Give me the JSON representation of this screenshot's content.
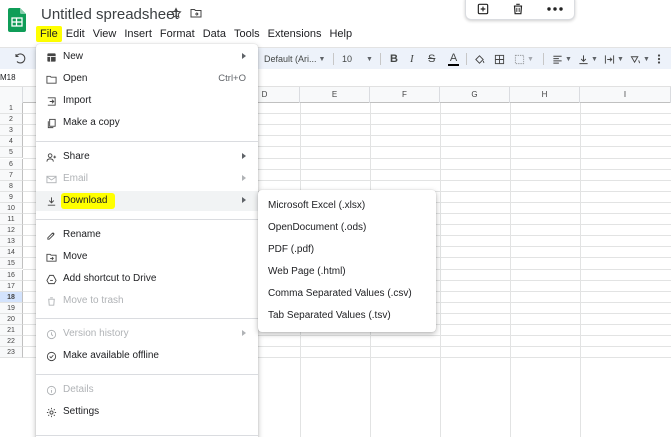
{
  "app": {
    "title": "Untitled spreadsheet",
    "brand_color": "#0f9d58",
    "highlight_color": "#ffff00"
  },
  "menubar": [
    "File",
    "Edit",
    "View",
    "Insert",
    "Format",
    "Data",
    "Tools",
    "Extensions",
    "Help"
  ],
  "toolbar": {
    "font": "Default (Ari...",
    "font_size": "10",
    "bold": "B",
    "italic": "I",
    "strike": "S",
    "text_color": "A"
  },
  "name_box": "M18",
  "columns": [
    "D",
    "E",
    "F",
    "G",
    "H",
    "I"
  ],
  "rows": [
    "1",
    "2",
    "3",
    "4",
    "5",
    "6",
    "7",
    "8",
    "9",
    "10",
    "11",
    "12",
    "13",
    "14",
    "15",
    "16",
    "17",
    "18",
    "19",
    "20",
    "21",
    "22",
    "23"
  ],
  "file_menu": [
    {
      "label": "New",
      "icon": "new-sheet-icon",
      "arrow": true
    },
    {
      "label": "Open",
      "icon": "folder-icon",
      "shortcut": "Ctrl+O"
    },
    {
      "label": "Import",
      "icon": "import-icon"
    },
    {
      "label": "Make a copy",
      "icon": "copy-icon"
    },
    {
      "label": "Share",
      "icon": "share-icon",
      "arrow": true
    },
    {
      "label": "Email",
      "icon": "email-icon",
      "arrow": true,
      "disabled": true
    },
    {
      "label": "Download",
      "icon": "download-icon",
      "arrow": true
    },
    {
      "label": "Rename",
      "icon": "rename-icon"
    },
    {
      "label": "Move",
      "icon": "move-icon"
    },
    {
      "label": "Add shortcut to Drive",
      "icon": "drive-shortcut-icon"
    },
    {
      "label": "Move to trash",
      "icon": "trash-icon",
      "disabled": true
    },
    {
      "label": "Version history",
      "icon": "history-icon",
      "arrow": true,
      "disabled": true
    },
    {
      "label": "Make available offline",
      "icon": "offline-icon"
    },
    {
      "label": "Details",
      "icon": "info-icon",
      "disabled": true
    },
    {
      "label": "Settings",
      "icon": "gear-icon"
    }
  ],
  "download_menu": [
    "Microsoft Excel (.xlsx)",
    "OpenDocument (.ods)",
    "PDF (.pdf)",
    "Web Page (.html)",
    "Comma Separated Values (.csv)",
    "Tab Separated Values (.tsv)"
  ]
}
